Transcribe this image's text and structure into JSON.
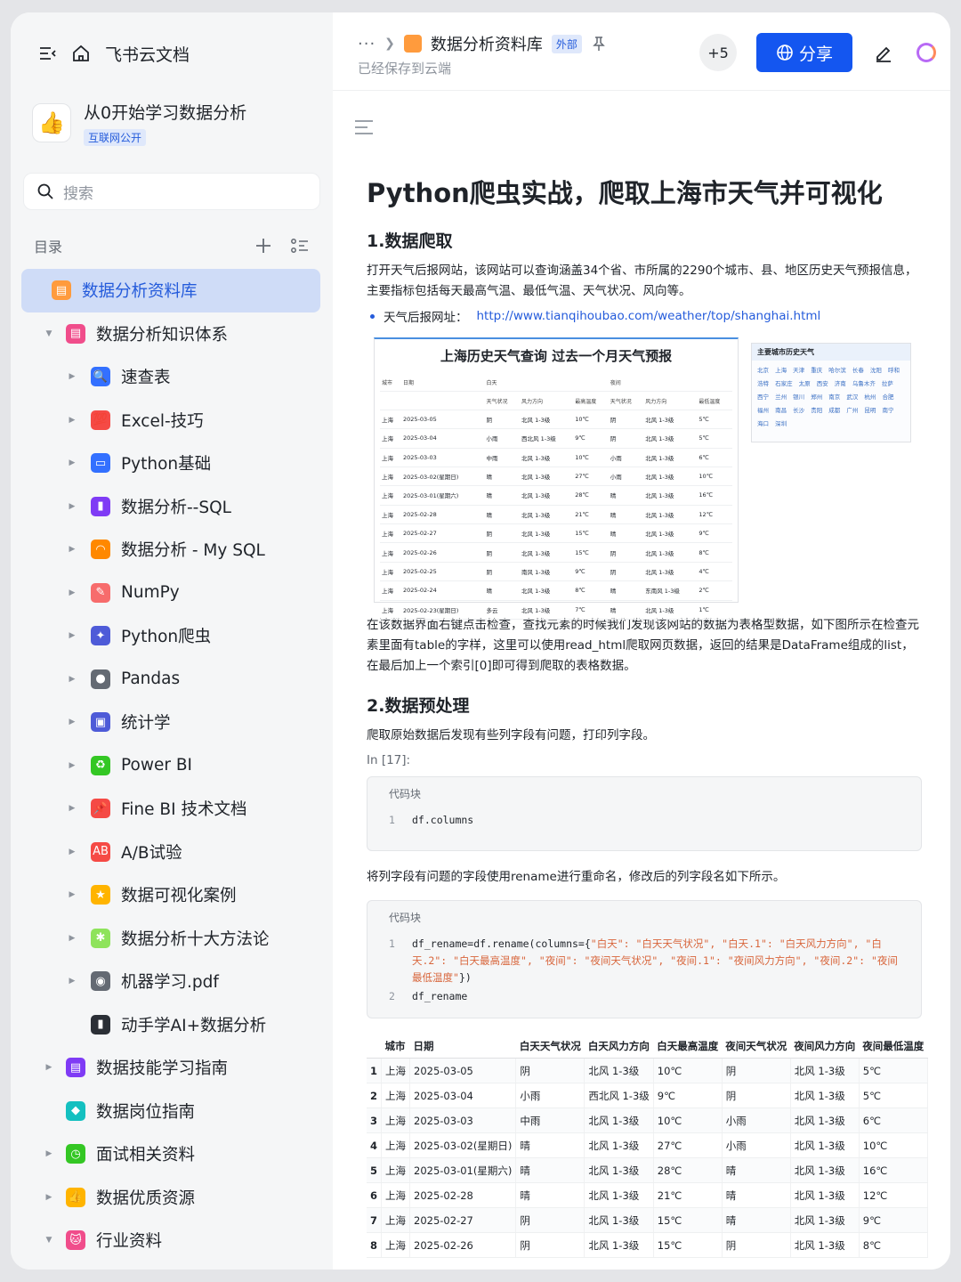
{
  "sidebar": {
    "brand": "飞书云文档",
    "space_name": "从0开始学习数据分析",
    "space_tag": "互联网公开",
    "search_placeholder": "搜索",
    "toc_label": "目录",
    "items": [
      {
        "label": "数据分析资料库",
        "level": 0,
        "selected": true,
        "caret": "",
        "icon_color": "#ff9b3d",
        "glyph": "▤"
      },
      {
        "label": "数据分析知识体系",
        "level": 0,
        "caret": "▼",
        "icon_color": "#f04d8b",
        "glyph": "▤"
      },
      {
        "label": "速查表",
        "level": 1,
        "caret": "▶",
        "icon_color": "#3370ff",
        "glyph": "🔍"
      },
      {
        "label": "Excel-技巧",
        "level": 1,
        "caret": "▶",
        "icon_color": "#f54a45",
        "glyph": "💯"
      },
      {
        "label": "Python基础",
        "level": 1,
        "caret": "▶",
        "icon_color": "#3370ff",
        "glyph": "▭"
      },
      {
        "label": "数据分析--SQL",
        "level": 1,
        "caret": "▶",
        "icon_color": "#7f3bf5",
        "glyph": "▮"
      },
      {
        "label": "数据分析 - My SQL",
        "level": 1,
        "caret": "▶",
        "icon_color": "#ff8800",
        "glyph": "◠"
      },
      {
        "label": "NumPy",
        "level": 1,
        "caret": "▶",
        "icon_color": "#f76c6c",
        "glyph": "✎"
      },
      {
        "label": "Python爬虫",
        "level": 1,
        "caret": "▶",
        "icon_color": "#4e5bd8",
        "glyph": "✦"
      },
      {
        "label": "Pandas",
        "level": 1,
        "caret": "▶",
        "icon_color": "#646a73",
        "glyph": "●"
      },
      {
        "label": "统计学",
        "level": 1,
        "caret": "▶",
        "icon_color": "#4e5bd8",
        "glyph": "▣"
      },
      {
        "label": "Power BI",
        "level": 1,
        "caret": "▶",
        "icon_color": "#34c724",
        "glyph": "♻"
      },
      {
        "label": "Fine BI 技术文档",
        "level": 1,
        "caret": "▶",
        "icon_color": "#f54a45",
        "glyph": "📌"
      },
      {
        "label": "A/B试验",
        "level": 1,
        "caret": "▶",
        "icon_color": "#f54a45",
        "glyph": "AB"
      },
      {
        "label": "数据可视化案例",
        "level": 1,
        "caret": "▶",
        "icon_color": "#ffb400",
        "glyph": "★"
      },
      {
        "label": "数据分析十大方法论",
        "level": 1,
        "caret": "▶",
        "icon_color": "#8ee35b",
        "glyph": "✱"
      },
      {
        "label": "机器学习.pdf",
        "level": 1,
        "caret": "▶",
        "icon_color": "#646a73",
        "glyph": "◉"
      },
      {
        "label": "动手学AI+数据分析",
        "level": 1,
        "caret": "",
        "icon_color": "#2b2f36",
        "glyph": "▮"
      },
      {
        "label": "数据技能学习指南",
        "level": 0,
        "caret": "▶",
        "icon_color": "#7f3bf5",
        "glyph": "▤"
      },
      {
        "label": "数据岗位指南",
        "level": 0,
        "caret": "",
        "icon_color": "#14c0c0",
        "glyph": "◆"
      },
      {
        "label": "面试相关资料",
        "level": 0,
        "caret": "▶",
        "icon_color": "#34c724",
        "glyph": "◷"
      },
      {
        "label": "数据优质资源",
        "level": 0,
        "caret": "▶",
        "icon_color": "#ffb400",
        "glyph": "👍"
      },
      {
        "label": "行业资料",
        "level": 0,
        "caret": "▼",
        "icon_color": "#f04d8b",
        "glyph": "🐱"
      }
    ]
  },
  "topbar": {
    "dots": "···",
    "doc_title": "数据分析资料库",
    "tag": "外部",
    "saved": "已经保存到云端",
    "collaborators": "+5",
    "share": "分享"
  },
  "doc": {
    "title": "Python爬虫实战，爬取上海市天气并可视化",
    "h_crawl": "1.数据爬取",
    "p_crawl": "打开天气后报网站，该网站可以查询涵盖34个省、市所属的2290个城市、县、地区历史天气预报信息，主要指标包括每天最高气温、最低气温、天气状况、风向等。",
    "bullet_label": "天气后报网址：",
    "bullet_link": "http://www.tianqihoubao.com/weather/top/shanghai.html",
    "shot": {
      "title": "上海历史天气查询 过去一个月天气预报",
      "side_title": "主要城市历史天气",
      "cities": "北京 上海 天津 重庆 哈尔滨 长春 沈阳 呼和浩特 石家庄 太原 西安 济南 乌鲁木齐 拉萨 西宁 兰州 银川 郑州 南京 武汉 杭州 合肥 福州 南昌 长沙 贵阳 成都 广州 昆明 南宁 海口 深圳",
      "head1": [
        "城市",
        "日期",
        "白天",
        "",
        "",
        "夜间",
        "",
        ""
      ],
      "head2": [
        "",
        "",
        "天气状况",
        "风力方向",
        "最高温度",
        "天气状况",
        "风力方向",
        "最低温度"
      ],
      "rows": [
        [
          "上海",
          "2025-03-05",
          "阴",
          "北风 1-3级",
          "10℃",
          "阴",
          "北风 1-3级",
          "5℃"
        ],
        [
          "上海",
          "2025-03-04",
          "小雨",
          "西北风 1-3级",
          "9℃",
          "阴",
          "北风 1-3级",
          "5℃"
        ],
        [
          "上海",
          "2025-03-03",
          "中雨",
          "北风 1-3级",
          "10℃",
          "小雨",
          "北风 1-3级",
          "6℃"
        ],
        [
          "上海",
          "2025-03-02(星期日)",
          "晴",
          "北风 1-3级",
          "27℃",
          "小雨",
          "北风 1-3级",
          "10℃"
        ],
        [
          "上海",
          "2025-03-01(星期六)",
          "晴",
          "北风 1-3级",
          "28℃",
          "晴",
          "北风 1-3级",
          "16℃"
        ],
        [
          "上海",
          "2025-02-28",
          "晴",
          "北风 1-3级",
          "21℃",
          "晴",
          "北风 1-3级",
          "12℃"
        ],
        [
          "上海",
          "2025-02-27",
          "阴",
          "北风 1-3级",
          "15℃",
          "晴",
          "北风 1-3级",
          "9℃"
        ],
        [
          "上海",
          "2025-02-26",
          "阴",
          "北风 1-3级",
          "15℃",
          "阴",
          "北风 1-3级",
          "8℃"
        ],
        [
          "上海",
          "2025-02-25",
          "阴",
          "南风 1-3级",
          "9℃",
          "阴",
          "北风 1-3级",
          "4℃"
        ],
        [
          "上海",
          "2025-02-24",
          "晴",
          "北风 1-3级",
          "8℃",
          "晴",
          "东南风 1-3级",
          "2℃"
        ],
        [
          "上海",
          "2025-02-23(星期日)",
          "多云",
          "北风 1-3级",
          "7℃",
          "晴",
          "北风 1-3级",
          "1℃"
        ]
      ]
    },
    "p_inspect": "在该数据界面右键点击检查，查找元素的时候我们发现该网站的数据为表格型数据，如下图所示在检查元素里面有table的字样，这里可以使用read_html爬取网页数据，返回的结果是DataFrame组成的list，在最后加上一个索引[0]即可得到爬取的表格数据。",
    "h_pre": "2.数据预处理",
    "p_pre": "爬取原始数据后发现有些列字段有问题，打印列字段。",
    "in_label": "In [17]:",
    "code_label": "代码块",
    "code1": {
      "ln": "1",
      "text": "df.columns"
    },
    "p_rename": "将列字段有问题的字段使用rename进行重命名，修改后的列字段名如下所示。",
    "code2_label": "代码块",
    "code2_line1_no": "1",
    "code2_line1_a": "df_rename=df.rename(columns={",
    "code2_line1_b": "\"白天\": \"白天天气状况\", \"白天.1\": \"白天风力方向\", \"白天.2\": \"白天最高温度\", \"夜间\": \"夜间天气状况\", \"夜间.1\": \"夜间风力方向\", \"夜间.2\": \"夜间最低温度\"",
    "code2_line1_c": "})",
    "code2_line2_no": "2",
    "code2_line2": "df_rename",
    "df_headers": [
      "",
      "城市",
      "日期",
      "白天天气状况",
      "白天风力方向",
      "白天最高温度",
      "夜间天气状况",
      "夜间风力方向",
      "夜间最低温度"
    ],
    "df_rows": [
      [
        "1",
        "上海",
        "2025-03-05",
        "阴",
        "北风 1-3级",
        "10℃",
        "阴",
        "北风 1-3级",
        "5℃"
      ],
      [
        "2",
        "上海",
        "2025-03-04",
        "小雨",
        "西北风 1-3级",
        "9℃",
        "阴",
        "北风 1-3级",
        "5℃"
      ],
      [
        "3",
        "上海",
        "2025-03-03",
        "中雨",
        "北风 1-3级",
        "10℃",
        "小雨",
        "北风 1-3级",
        "6℃"
      ],
      [
        "4",
        "上海",
        "2025-03-02(星期日)",
        "晴",
        "北风 1-3级",
        "27℃",
        "小雨",
        "北风 1-3级",
        "10℃"
      ],
      [
        "5",
        "上海",
        "2025-03-01(星期六)",
        "晴",
        "北风 1-3级",
        "28℃",
        "晴",
        "北风 1-3级",
        "16℃"
      ],
      [
        "6",
        "上海",
        "2025-02-28",
        "晴",
        "北风 1-3级",
        "21℃",
        "晴",
        "北风 1-3级",
        "12℃"
      ],
      [
        "7",
        "上海",
        "2025-02-27",
        "阴",
        "北风 1-3级",
        "15℃",
        "晴",
        "北风 1-3级",
        "9℃"
      ],
      [
        "8",
        "上海",
        "2025-02-26",
        "阴",
        "北风 1-3级",
        "15℃",
        "阴",
        "北风 1-3级",
        "8℃"
      ]
    ]
  }
}
